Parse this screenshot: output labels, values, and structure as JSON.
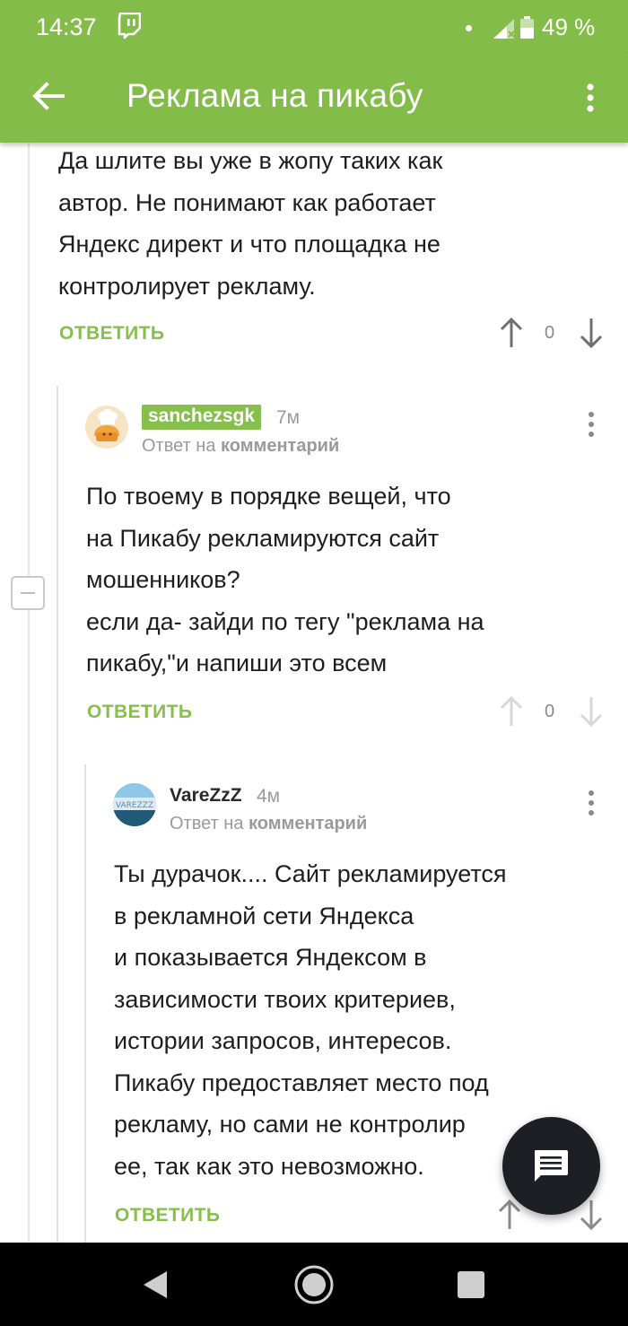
{
  "status_bar": {
    "time": "14:37",
    "battery": "49 %"
  },
  "app_bar": {
    "title": "Реклама на пикабу"
  },
  "comments": [
    {
      "text": "Да шлите вы уже в жопу таких как\nавтор. Не понимают как работает\nЯндекс директ и что площадка не\nконтролирует рекламу.",
      "reply_label": "ОТВЕТИТЬ",
      "score": "0"
    },
    {
      "username": "sanchezsgk",
      "time": "7м",
      "reply_to_prefix": "Ответ на",
      "reply_to_target": "комментарий",
      "text": "По твоему в порядке вещей, что\nна Пикабу рекламируются сайт\nмошенников?\nесли да- зайди по тегу \"реклама на\nпикабу,\"и напиши это всем",
      "reply_label": "ОТВЕТИТЬ",
      "score": "0"
    },
    {
      "username": "VareZzZ",
      "time": "4м",
      "reply_to_prefix": "Ответ на",
      "reply_to_target": "комментарий",
      "text": "Ты дурачок.... Сайт рекламируется\nв рекламной сети Яндекса\nи показывается Яндексом в\nзависимости твоих критериев,\nистории запросов, интересов.\nПикабу предоставляет место под\nрекламу, но сами не контролир\nее, так как это невозможно.",
      "reply_label": "ОТВЕТИТЬ"
    }
  ],
  "colors": {
    "brand": "#83bc48",
    "accent": "#86bf4b"
  },
  "icons": [
    "twitch-icon",
    "signal-icon",
    "battery-icon",
    "arrow-back-icon",
    "more-vert-icon",
    "arrow-up-icon",
    "arrow-down-icon",
    "collapse-icon",
    "chat-icon",
    "nav-back-icon",
    "nav-home-icon",
    "nav-recents-icon"
  ]
}
